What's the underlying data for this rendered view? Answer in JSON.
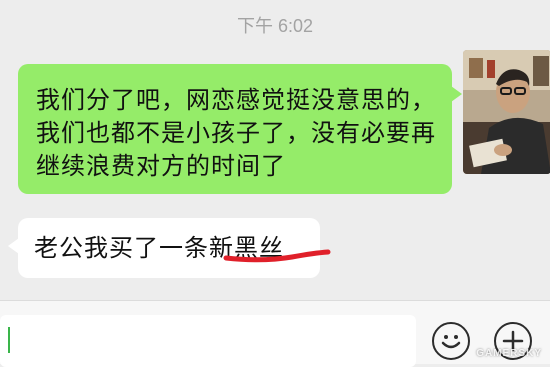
{
  "chat": {
    "timestamp": "下午 6:02",
    "messages": [
      {
        "direction": "outgoing",
        "text": "我们分了吧，网恋感觉挺没意思的，我们也都不是小孩子了，没有必要再继续浪费对方的时间了"
      },
      {
        "direction": "incoming",
        "text": "老公我买了一条新黑丝",
        "annotation": "red-underline"
      }
    ]
  },
  "input_bar": {
    "message_value": "",
    "emoji_icon": "smiley-face-icon",
    "more_icon": "plus-icon"
  },
  "watermark": "GAMERSKY",
  "colors": {
    "background": "#ededed",
    "outgoing_bubble": "#95ec69",
    "incoming_bubble": "#ffffff",
    "timestamp_text": "#a3a3a3",
    "annotation": "#e0202a",
    "caret": "#3ab54a"
  }
}
